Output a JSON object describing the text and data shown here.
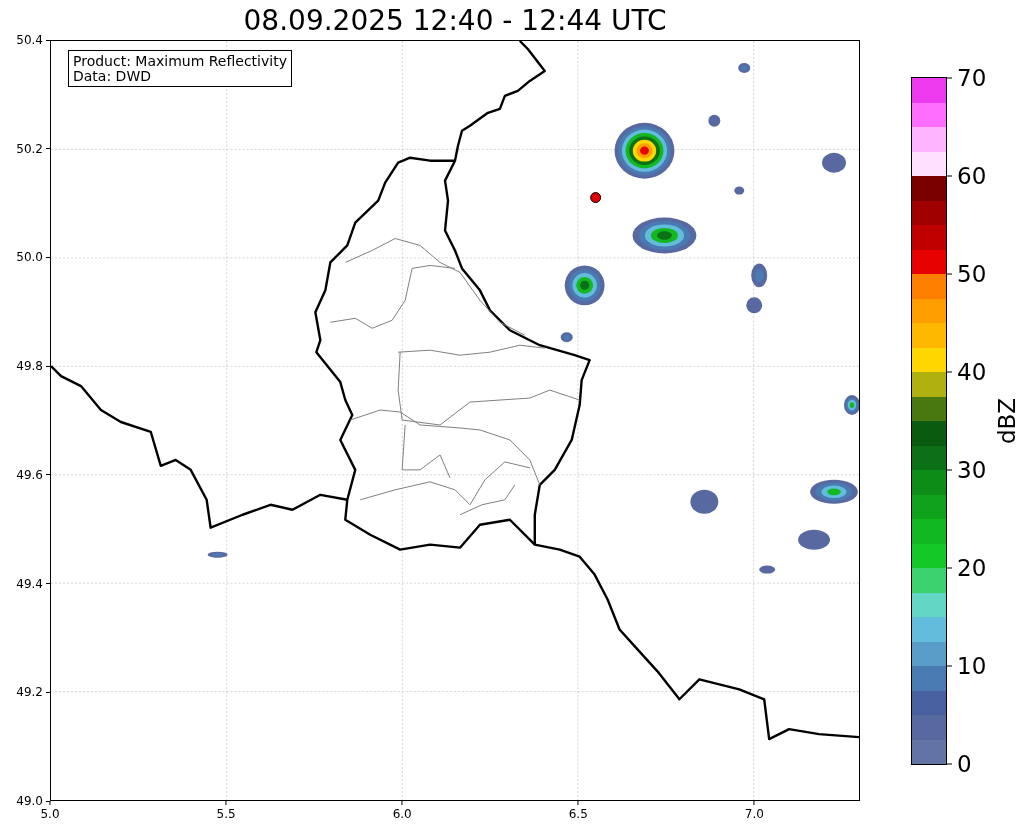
{
  "title": "08.09.2025 12:40 - 12:44 UTC",
  "legend": {
    "lines": [
      "Product: Maximum Reflectivity",
      "Data: DWD"
    ]
  },
  "x_axis": {
    "ticks": [
      "5.0",
      "5.5",
      "6.0",
      "6.5",
      "7.0"
    ]
  },
  "y_axis": {
    "ticks": [
      "50.4",
      "50.2",
      "50.0",
      "49.8",
      "49.6",
      "49.4",
      "49.2",
      "49.0"
    ]
  },
  "colorbar": {
    "label": "dBZ",
    "ticks": [
      "70",
      "60",
      "50",
      "40",
      "30",
      "20",
      "10",
      "0"
    ],
    "bins": [
      {
        "color": "#6274a4"
      },
      {
        "color": "#5868a0"
      },
      {
        "color": "#4860a0"
      },
      {
        "color": "#4a7ab2"
      },
      {
        "color": "#5a9cc8"
      },
      {
        "color": "#64bcdc"
      },
      {
        "color": "#64d6c6"
      },
      {
        "color": "#3cd270"
      },
      {
        "color": "#14c828"
      },
      {
        "color": "#12b820"
      },
      {
        "color": "#0fa21a"
      },
      {
        "color": "#0d8c18"
      },
      {
        "color": "#0b7016"
      },
      {
        "color": "#0a5a10"
      },
      {
        "color": "#4a7810"
      },
      {
        "color": "#b0b010"
      },
      {
        "color": "#ffd700"
      },
      {
        "color": "#ffb800"
      },
      {
        "color": "#ff9e00"
      },
      {
        "color": "#ff8000"
      },
      {
        "color": "#e60000"
      },
      {
        "color": "#c00000"
      },
      {
        "color": "#a00000"
      },
      {
        "color": "#7a0000"
      },
      {
        "color": "#ffe0ff"
      },
      {
        "color": "#ffb4ff"
      },
      {
        "color": "#ff6eff"
      },
      {
        "color": "#ee3aee"
      }
    ]
  }
}
